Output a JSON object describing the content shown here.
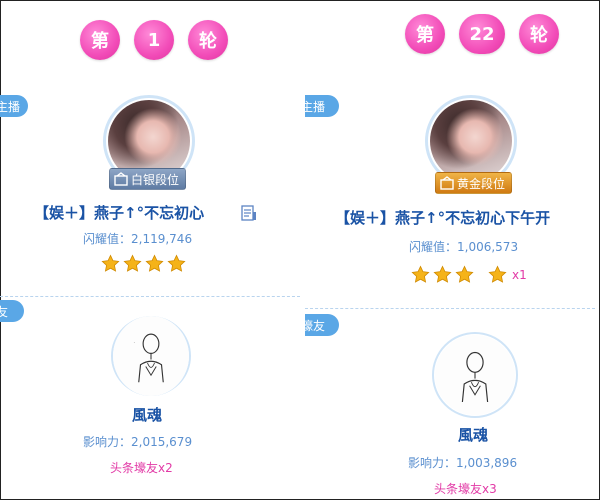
{
  "left": {
    "round": {
      "prefix": "第",
      "number": "1",
      "suffix": "轮"
    },
    "host_tab": "主播",
    "host_badge": "白银段位",
    "host_name": "【娱＋】燕子↑°不忘初心",
    "host_metric_label": "闪耀值",
    "host_metric_value": "闪耀值：2,119,746",
    "host_stars": 4,
    "friend_tab": "友",
    "friend_name": "風魂",
    "friend_metric": "影响力：2,015,679",
    "friend_tag": "头条壕友x2"
  },
  "right": {
    "round": {
      "prefix": "第",
      "number": "22",
      "suffix": "轮"
    },
    "host_tab": "主播",
    "host_badge": "黄金段位",
    "host_name": "【娱＋】燕子↑°不忘初心下午开",
    "host_metric_value": "闪耀值：1,006,573",
    "host_stars": 3,
    "extra_star_multiplier": "x1",
    "friend_tab": "壕友",
    "friend_name": "風魂",
    "friend_metric": "影响力：1,003,896",
    "friend_tag": "头条壕友x3"
  },
  "colors": {
    "pink": "#f24cb8",
    "blue": "#1a53a5",
    "tab": "#5aa7e6",
    "star": "#f5b319"
  }
}
